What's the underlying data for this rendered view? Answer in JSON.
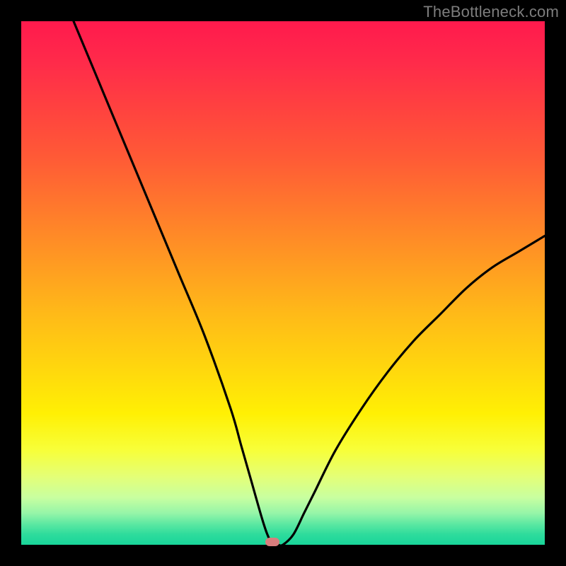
{
  "watermark": "TheBottleneck.com",
  "colors": {
    "frame": "#000000",
    "curve": "#000000",
    "marker": "#d87d7d",
    "watermark": "#7d7d7d"
  },
  "chart_data": {
    "type": "line",
    "title": "",
    "xlabel": "",
    "ylabel": "",
    "xlim": [
      0,
      100
    ],
    "ylim": [
      0,
      100
    ],
    "grid": false,
    "legend": false,
    "series": [
      {
        "name": "bottleneck-curve",
        "x": [
          10,
          15,
          20,
          25,
          30,
          35,
          40,
          42,
          44,
          46,
          47,
          48,
          49,
          50,
          52,
          54,
          56,
          60,
          65,
          70,
          75,
          80,
          85,
          90,
          95,
          100
        ],
        "y": [
          100,
          88,
          76,
          64,
          52,
          40,
          26,
          19,
          12,
          5,
          2,
          0,
          0,
          0,
          2,
          6,
          10,
          18,
          26,
          33,
          39,
          44,
          49,
          53,
          56,
          59
        ]
      }
    ],
    "min_point": {
      "x": 48,
      "y": 0
    },
    "background_gradient": {
      "top": "#ff1a4d",
      "mid": "#fff004",
      "bottom": "#19d59a"
    }
  }
}
